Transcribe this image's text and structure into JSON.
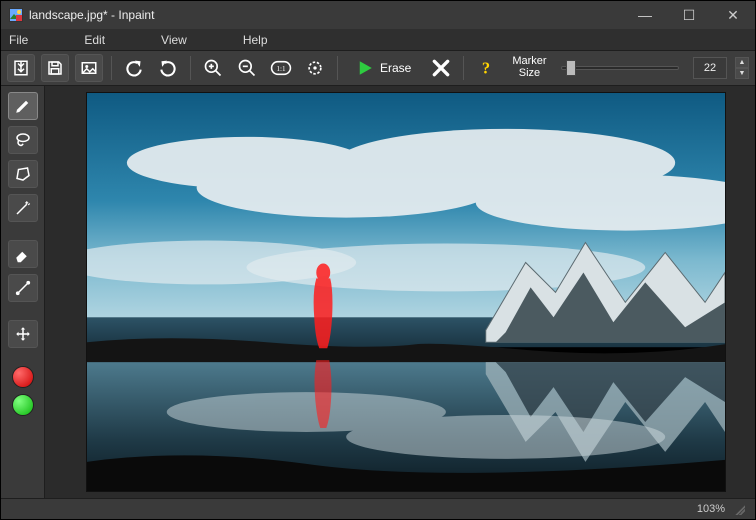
{
  "window": {
    "title": "landscape.jpg* - Inpaint",
    "minimize_glyph": "—",
    "maximize_glyph": "☐",
    "close_glyph": "✕"
  },
  "menu": {
    "file": "File",
    "edit": "Edit",
    "view": "View",
    "help": "Help"
  },
  "toolbar": {
    "erase_label": "Erase",
    "marker_label_line1": "Marker",
    "marker_label_line2": "Size",
    "marker_size_value": "22"
  },
  "status": {
    "zoom": "103%"
  },
  "icons": {
    "open": "open-icon",
    "save": "save-icon",
    "save_as": "save-as-icon",
    "undo": "undo-icon",
    "redo": "redo-icon",
    "zoom_in": "zoom-in-icon",
    "zoom_out": "zoom-out-icon",
    "zoom_1to1": "zoom-1to1-icon",
    "zoom_fit": "zoom-fit-icon",
    "erase_play": "play-icon",
    "cancel": "cancel-x-icon",
    "help": "help-question-icon",
    "marker_tool": "marker-tool-icon",
    "lasso_tool": "lasso-tool-icon",
    "polygon_tool": "polygon-tool-icon",
    "magic_wand_tool": "magic-wand-tool-icon",
    "eraser_tool": "eraser-tool-icon",
    "line_tool": "line-tool-icon",
    "move_tool": "move-tool-icon"
  }
}
